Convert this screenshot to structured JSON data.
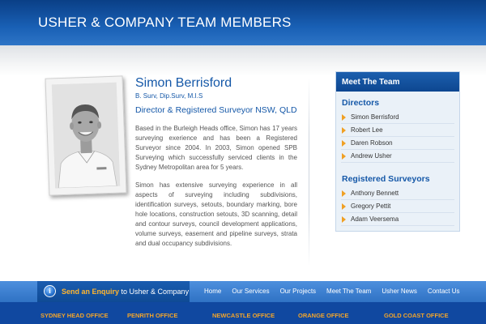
{
  "header": {
    "title": "USHER & COMPANY TEAM MEMBERS"
  },
  "profile": {
    "name": "Simon Berrisford",
    "qualifications": "B. Surv, Dip.Surv, M.I.S",
    "role": "Director & Registered Surveyor NSW, QLD",
    "bio": [
      "Based in the Burleigh Heads office, Simon has 17 years surveying exerience and has been a Registered Surveyor since 2004. In 2003, Simon opened SPB Surveying which successfully serviced clients in the Sydney Metropolitan area for 5 years.",
      "Simon has extensive surveying experience in all aspects of surveying including subdivisions, identification surveys, setouts, boundary marking, bore hole locations, construction setouts, 3D scanning, detail and contour surveys, council development applications, volume surveys, easement and pipeline surveys, strata and dual occupancy subdivisions."
    ]
  },
  "sidebar": {
    "title": "Meet The Team",
    "sections": [
      {
        "heading": "Directors",
        "items": [
          "Simon Berrisford",
          "Robert Lee",
          "Daren Robson",
          "Andrew Usher"
        ]
      },
      {
        "heading": "Registered Surveyors",
        "items": [
          "Anthony Bennett",
          "Gregory Pettit",
          "Adam Veersema"
        ]
      }
    ]
  },
  "footer": {
    "enquiry_badge": "i",
    "enquiry_highlight": "Send an Enquiry",
    "enquiry_rest": "to Usher & Company",
    "nav": [
      "Home",
      "Our Services",
      "Our Projects",
      "Meet The Team",
      "Usher News",
      "Contact Us"
    ],
    "offices": [
      "SYDNEY HEAD OFFICE",
      "PENRITH OFFICE",
      "NEWCASTLE OFFICE",
      "ORANGE OFFICE",
      "GOLD COAST OFFICE"
    ]
  },
  "colors": {
    "brand_blue": "#1558a8",
    "accent_orange": "#f0a024",
    "header_blue": "#0a3f86"
  }
}
